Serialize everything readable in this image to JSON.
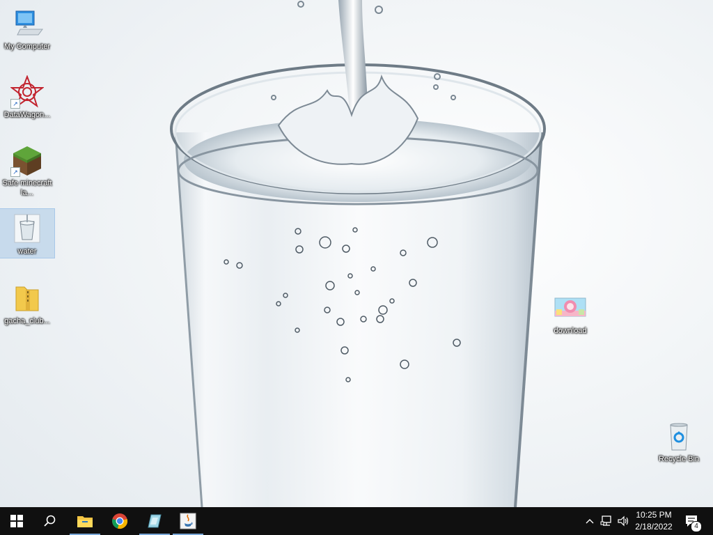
{
  "desktop": {
    "icons": [
      {
        "label": "My Computer",
        "icon": "computer-icon"
      },
      {
        "label": "DataWagon...",
        "icon": "datawagon-icon",
        "shortcut": true
      },
      {
        "label": "Safe minecraft la...",
        "icon": "minecraft-icon",
        "shortcut": true
      },
      {
        "label": "water",
        "icon": "water-image-icon",
        "selected": true
      },
      {
        "label": "gacha_club...",
        "icon": "zip-folder-icon"
      },
      {
        "label": "download",
        "icon": "image-file-icon"
      },
      {
        "label": "Recycle Bin",
        "icon": "recycle-bin-icon"
      }
    ]
  },
  "taskbar": {
    "start": "windows-logo-icon",
    "search": "search-icon",
    "pinned": [
      {
        "name": "file-explorer",
        "icon": "folder-icon",
        "active": true
      },
      {
        "name": "chrome",
        "icon": "chrome-icon",
        "active": false
      },
      {
        "name": "water-viewer",
        "icon": "photo-icon",
        "active": true
      },
      {
        "name": "java",
        "icon": "java-icon",
        "active": true
      }
    ],
    "tray": {
      "time": "10:25 PM",
      "date": "2/18/2022",
      "notification_count": "4"
    }
  },
  "colors": {
    "taskbar": "#101010",
    "accent": "#7aa7d8"
  }
}
